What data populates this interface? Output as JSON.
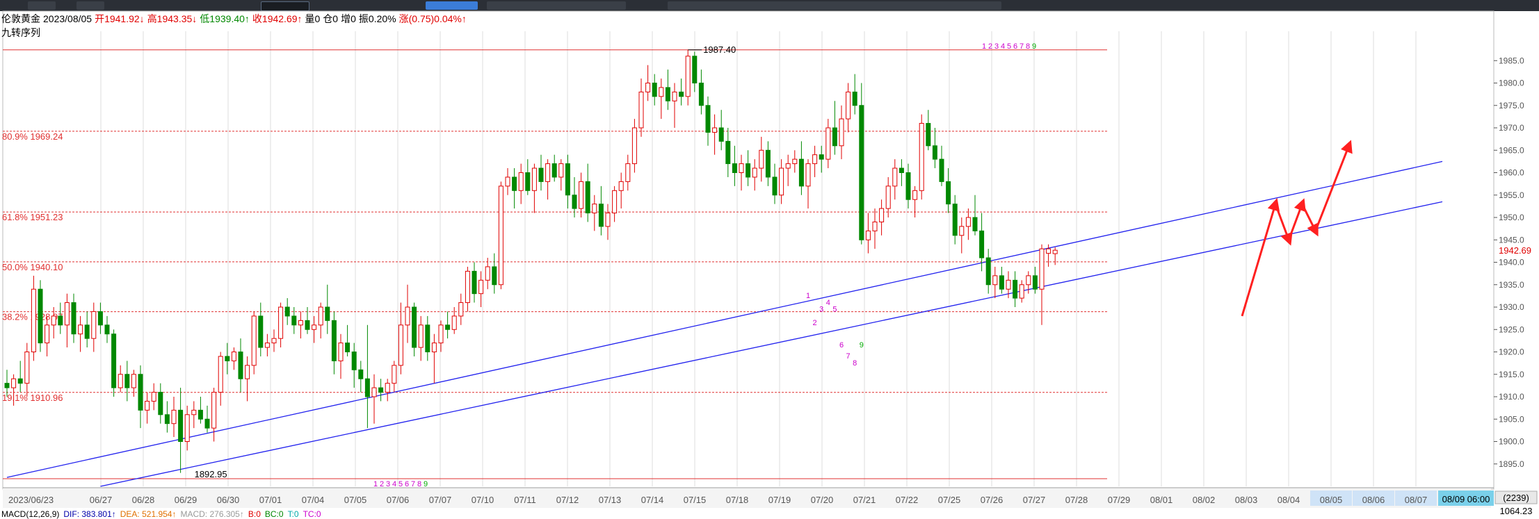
{
  "header": {
    "name": "伦敦黄金",
    "date": "2023/08/05",
    "open": "开1941.92↓",
    "high": "高1943.35↓",
    "low": "低1939.40↑",
    "close": "收1942.69↑",
    "vol": "量0",
    "oi": "仓0",
    "inc": "增0",
    "amp": "振0.20%",
    "chg": "涨(0.75)0.04%↑"
  },
  "subtitle": "九转序列",
  "colors": {
    "up": "#e00000",
    "down": "#008800",
    "trend": "#2020ee",
    "arrow": "#ff2020",
    "fib": "#e03030",
    "td": "#cc00cc",
    "td9": "#00aa00",
    "grid": "#dcdcdc"
  },
  "chart_data": {
    "type": "candlestick",
    "ylim": [
      1890,
      1990
    ],
    "yticks": [
      1895,
      1900,
      1905,
      1910,
      1915,
      1920,
      1925,
      1930,
      1935,
      1940,
      1945,
      1950,
      1955,
      1960,
      1965,
      1970,
      1975,
      1980,
      1985
    ],
    "last_price": "1942.69",
    "x_start_label": "2023/06/23",
    "x_labels": [
      "06/27",
      "06/28",
      "06/29",
      "06/30",
      "07/01",
      "07/04",
      "07/05",
      "07/06",
      "07/07",
      "07/10",
      "07/11",
      "07/12",
      "07/13",
      "07/14",
      "07/15",
      "07/18",
      "07/19",
      "07/20",
      "07/21",
      "07/22",
      "07/25",
      "07/26",
      "07/27",
      "07/28",
      "07/29",
      "08/01",
      "08/02",
      "08/03",
      "08/04",
      "08/05",
      "08/06",
      "08/07"
    ],
    "x_cursor_label": "08/09 06:00",
    "bottom_right_labels": [
      "(2239)",
      "1064.23"
    ],
    "fib_levels": [
      {
        "label": "80.9% 1969.24",
        "value": 1969.24
      },
      {
        "label": "61.8% 1951.23",
        "value": 1951.23
      },
      {
        "label": "50.0% 1940.10",
        "value": 1940.1
      },
      {
        "label": "38.2% 1928.97",
        "value": 1928.97
      },
      {
        "label": "19.1% 1910.96",
        "value": 1910.96
      }
    ],
    "range_levels": [
      {
        "label": "1987.40",
        "value": 1987.4
      },
      {
        "label": "1892.95",
        "value": 1892.95
      }
    ],
    "candles": [
      [
        1913,
        1916,
        1910,
        1912
      ],
      [
        1912,
        1915,
        1908,
        1914
      ],
      [
        1914,
        1918,
        1911,
        1913
      ],
      [
        1913,
        1922,
        1910,
        1920
      ],
      [
        1920,
        1937,
        1918,
        1934
      ],
      [
        1934,
        1936,
        1920,
        1922
      ],
      [
        1922,
        1928,
        1919,
        1926
      ],
      [
        1926,
        1930,
        1923,
        1928
      ],
      [
        1928,
        1931,
        1924,
        1926
      ],
      [
        1926,
        1933,
        1921,
        1931
      ],
      [
        1931,
        1933,
        1922,
        1924
      ],
      [
        1924,
        1928,
        1920,
        1926
      ],
      [
        1926,
        1929,
        1921,
        1923
      ],
      [
        1923,
        1931,
        1920,
        1929
      ],
      [
        1929,
        1931,
        1924,
        1926
      ],
      [
        1926,
        1928,
        1922,
        1924
      ],
      [
        1924,
        1925,
        1910,
        1912
      ],
      [
        1912,
        1917,
        1911,
        1915
      ],
      [
        1915,
        1918,
        1909,
        1912
      ],
      [
        1912,
        1916,
        1910,
        1915
      ],
      [
        1915,
        1917,
        1903,
        1907
      ],
      [
        1907,
        1911,
        1904,
        1909
      ],
      [
        1909,
        1913,
        1907,
        1911
      ],
      [
        1911,
        1913,
        1904,
        1906
      ],
      [
        1906,
        1909,
        1902,
        1904
      ],
      [
        1904,
        1910,
        1901,
        1907
      ],
      [
        1907,
        1912,
        1893,
        1900
      ],
      [
        1900,
        1908,
        1898,
        1906
      ],
      [
        1906,
        1909,
        1903,
        1907
      ],
      [
        1907,
        1910,
        1904,
        1905
      ],
      [
        1905,
        1908,
        1902,
        1903
      ],
      [
        1903,
        1912,
        1900,
        1911
      ],
      [
        1911,
        1920,
        1908,
        1919
      ],
      [
        1919,
        1922,
        1915,
        1918
      ],
      [
        1918,
        1921,
        1916,
        1920
      ],
      [
        1920,
        1923,
        1911,
        1914
      ],
      [
        1914,
        1919,
        1909,
        1917
      ],
      [
        1917,
        1929,
        1915,
        1928
      ],
      [
        1928,
        1931,
        1919,
        1921
      ],
      [
        1921,
        1924,
        1919,
        1922
      ],
      [
        1922,
        1925,
        1920,
        1923
      ],
      [
        1923,
        1931,
        1921,
        1930
      ],
      [
        1930,
        1932,
        1926,
        1928
      ],
      [
        1928,
        1930,
        1924,
        1926
      ],
      [
        1926,
        1929,
        1923,
        1927
      ],
      [
        1927,
        1930,
        1924,
        1925
      ],
      [
        1925,
        1928,
        1922,
        1926
      ],
      [
        1926,
        1931,
        1923,
        1930
      ],
      [
        1930,
        1935,
        1924,
        1927
      ],
      [
        1927,
        1929,
        1915,
        1918
      ],
      [
        1918,
        1924,
        1914,
        1922
      ],
      [
        1922,
        1926,
        1919,
        1920
      ],
      [
        1920,
        1922,
        1912,
        1916
      ],
      [
        1916,
        1918,
        1911,
        1914
      ],
      [
        1914,
        1926,
        1903,
        1910
      ],
      [
        1910,
        1915,
        1904,
        1912
      ],
      [
        1912,
        1914,
        1909,
        1911
      ],
      [
        1911,
        1914,
        1909,
        1913
      ],
      [
        1913,
        1918,
        1911,
        1917
      ],
      [
        1917,
        1931,
        1915,
        1926
      ],
      [
        1926,
        1935,
        1922,
        1930
      ],
      [
        1930,
        1931,
        1919,
        1921
      ],
      [
        1921,
        1928,
        1918,
        1926
      ],
      [
        1926,
        1928,
        1918,
        1920
      ],
      [
        1920,
        1924,
        1913,
        1922
      ],
      [
        1922,
        1927,
        1920,
        1926
      ],
      [
        1926,
        1929,
        1923,
        1925
      ],
      [
        1925,
        1930,
        1924,
        1928
      ],
      [
        1928,
        1933,
        1926,
        1931
      ],
      [
        1931,
        1939,
        1929,
        1938
      ],
      [
        1938,
        1940,
        1931,
        1933
      ],
      [
        1933,
        1938,
        1930,
        1936
      ],
      [
        1936,
        1941,
        1934,
        1939
      ],
      [
        1939,
        1942,
        1933,
        1935
      ],
      [
        1935,
        1958,
        1934,
        1957
      ],
      [
        1957,
        1961,
        1955,
        1959
      ],
      [
        1959,
        1961,
        1952,
        1956
      ],
      [
        1956,
        1962,
        1953,
        1960
      ],
      [
        1960,
        1963,
        1955,
        1956
      ],
      [
        1956,
        1962,
        1951,
        1961
      ],
      [
        1961,
        1964,
        1956,
        1958
      ],
      [
        1958,
        1963,
        1954,
        1962
      ],
      [
        1962,
        1964,
        1958,
        1959
      ],
      [
        1959,
        1963,
        1956,
        1962
      ],
      [
        1962,
        1964,
        1952,
        1955
      ],
      [
        1955,
        1959,
        1950,
        1952
      ],
      [
        1952,
        1960,
        1950,
        1958
      ],
      [
        1958,
        1962,
        1949,
        1951
      ],
      [
        1951,
        1955,
        1947,
        1953
      ],
      [
        1953,
        1957,
        1946,
        1948
      ],
      [
        1948,
        1953,
        1945,
        1951
      ],
      [
        1951,
        1957,
        1949,
        1956
      ],
      [
        1956,
        1960,
        1952,
        1958
      ],
      [
        1958,
        1964,
        1956,
        1962
      ],
      [
        1962,
        1972,
        1960,
        1970
      ],
      [
        1970,
        1981,
        1968,
        1978
      ],
      [
        1978,
        1984,
        1976,
        1980
      ],
      [
        1980,
        1982,
        1975,
        1977
      ],
      [
        1977,
        1981,
        1972,
        1979
      ],
      [
        1979,
        1983,
        1974,
        1976
      ],
      [
        1976,
        1980,
        1970,
        1978
      ],
      [
        1978,
        1981,
        1975,
        1977
      ],
      [
        1977,
        1987.4,
        1975,
        1986
      ],
      [
        1986,
        1987,
        1978,
        1980
      ],
      [
        1980,
        1983,
        1973,
        1975
      ],
      [
        1975,
        1977,
        1966,
        1969
      ],
      [
        1969,
        1973,
        1964,
        1970
      ],
      [
        1970,
        1974,
        1965,
        1967
      ],
      [
        1967,
        1970,
        1959,
        1962
      ],
      [
        1962,
        1966,
        1957,
        1960
      ],
      [
        1960,
        1964,
        1956,
        1962
      ],
      [
        1962,
        1965,
        1957,
        1959
      ],
      [
        1959,
        1963,
        1956,
        1961
      ],
      [
        1961,
        1968,
        1958,
        1965
      ],
      [
        1965,
        1967,
        1957,
        1959
      ],
      [
        1959,
        1962,
        1953,
        1955
      ],
      [
        1955,
        1963,
        1953,
        1961
      ],
      [
        1961,
        1964,
        1957,
        1962
      ],
      [
        1962,
        1965,
        1960,
        1963
      ],
      [
        1963,
        1967,
        1955,
        1957
      ],
      [
        1957,
        1963,
        1952,
        1962
      ],
      [
        1962,
        1966,
        1959,
        1964
      ],
      [
        1964,
        1966,
        1960,
        1963
      ],
      [
        1963,
        1972,
        1961,
        1970
      ],
      [
        1970,
        1976,
        1964,
        1966
      ],
      [
        1966,
        1975,
        1963,
        1972
      ],
      [
        1972,
        1980,
        1969,
        1978
      ],
      [
        1978,
        1982,
        1973,
        1975
      ],
      [
        1975,
        1980,
        1944,
        1945
      ],
      [
        1945,
        1951,
        1942,
        1947
      ],
      [
        1947,
        1952,
        1943,
        1949
      ],
      [
        1949,
        1954,
        1946,
        1952
      ],
      [
        1952,
        1959,
        1950,
        1957
      ],
      [
        1957,
        1963,
        1954,
        1961
      ],
      [
        1961,
        1963,
        1957,
        1960
      ],
      [
        1960,
        1962,
        1952,
        1954
      ],
      [
        1954,
        1957,
        1950,
        1956
      ],
      [
        1956,
        1973,
        1954,
        1971
      ],
      [
        1971,
        1974,
        1965,
        1966
      ],
      [
        1966,
        1970,
        1961,
        1963
      ],
      [
        1963,
        1966,
        1957,
        1958
      ],
      [
        1958,
        1961,
        1951,
        1953
      ],
      [
        1953,
        1955,
        1944,
        1946
      ],
      [
        1946,
        1950,
        1942,
        1948
      ],
      [
        1948,
        1952,
        1945,
        1950
      ],
      [
        1950,
        1955,
        1946,
        1947
      ],
      [
        1947,
        1951,
        1938,
        1941
      ],
      [
        1941,
        1943,
        1933,
        1935
      ],
      [
        1935,
        1939,
        1932,
        1937
      ],
      [
        1937,
        1939,
        1933,
        1934
      ],
      [
        1934,
        1938,
        1932,
        1936
      ],
      [
        1936,
        1938,
        1930,
        1932
      ],
      [
        1932,
        1936,
        1931,
        1935
      ],
      [
        1935,
        1938,
        1933,
        1937
      ],
      [
        1937,
        1939,
        1933,
        1934
      ],
      [
        1934,
        1944,
        1926,
        1943
      ],
      [
        1942,
        1944,
        1939,
        1943
      ],
      [
        1941.92,
        1943.35,
        1939.4,
        1942.69
      ]
    ],
    "td_marks": [
      {
        "label": "1",
        "value": 1932,
        "i": 120
      },
      {
        "label": "2",
        "value": 1926,
        "i": 121
      },
      {
        "label": "3",
        "value": 1929,
        "i": 122
      },
      {
        "label": "4",
        "value": 1930.5,
        "i": 123
      },
      {
        "label": "5",
        "value": 1929,
        "i": 124
      },
      {
        "label": "6",
        "value": 1921,
        "i": 125
      },
      {
        "label": "7",
        "value": 1918.5,
        "i": 126
      },
      {
        "label": "8",
        "value": 1917,
        "i": 127
      },
      {
        "label": "9",
        "value": 1921,
        "i": 128
      }
    ],
    "td_top": [
      "1",
      "2",
      "3",
      "4",
      "5",
      "6",
      "7",
      "8",
      "9"
    ],
    "td_bottom": [
      "1",
      "2",
      "3",
      "4",
      "5",
      "6",
      "7",
      "8",
      "9"
    ],
    "trendlines": [
      {
        "i1": 0,
        "v1": 1892,
        "i2": 215,
        "v2": 1962.5
      },
      {
        "i1": 14,
        "v1": 1890,
        "i2": 215,
        "v2": 1953.5
      }
    ],
    "arrows": [
      {
        "i1": 185,
        "v1": 1928,
        "i2": 190,
        "v2": 1953
      },
      {
        "i1": 190,
        "v1": 1953,
        "i2": 192,
        "v2": 1945
      },
      {
        "i1": 192,
        "v1": 1945,
        "i2": 194,
        "v2": 1953
      },
      {
        "i1": 194,
        "v1": 1953,
        "i2": 196,
        "v2": 1947
      },
      {
        "i1": 196,
        "v1": 1947,
        "i2": 201,
        "v2": 1966
      }
    ]
  },
  "macd": {
    "title": "MACD(12,26,9)",
    "dif": "DIF: 383.801↑",
    "dea": "DEA: 521.954↑",
    "macd": "MACD: 276.305↑",
    "b": "B:0",
    "bc": "BC:0",
    "t": "T:0",
    "tc": "TC:0"
  }
}
